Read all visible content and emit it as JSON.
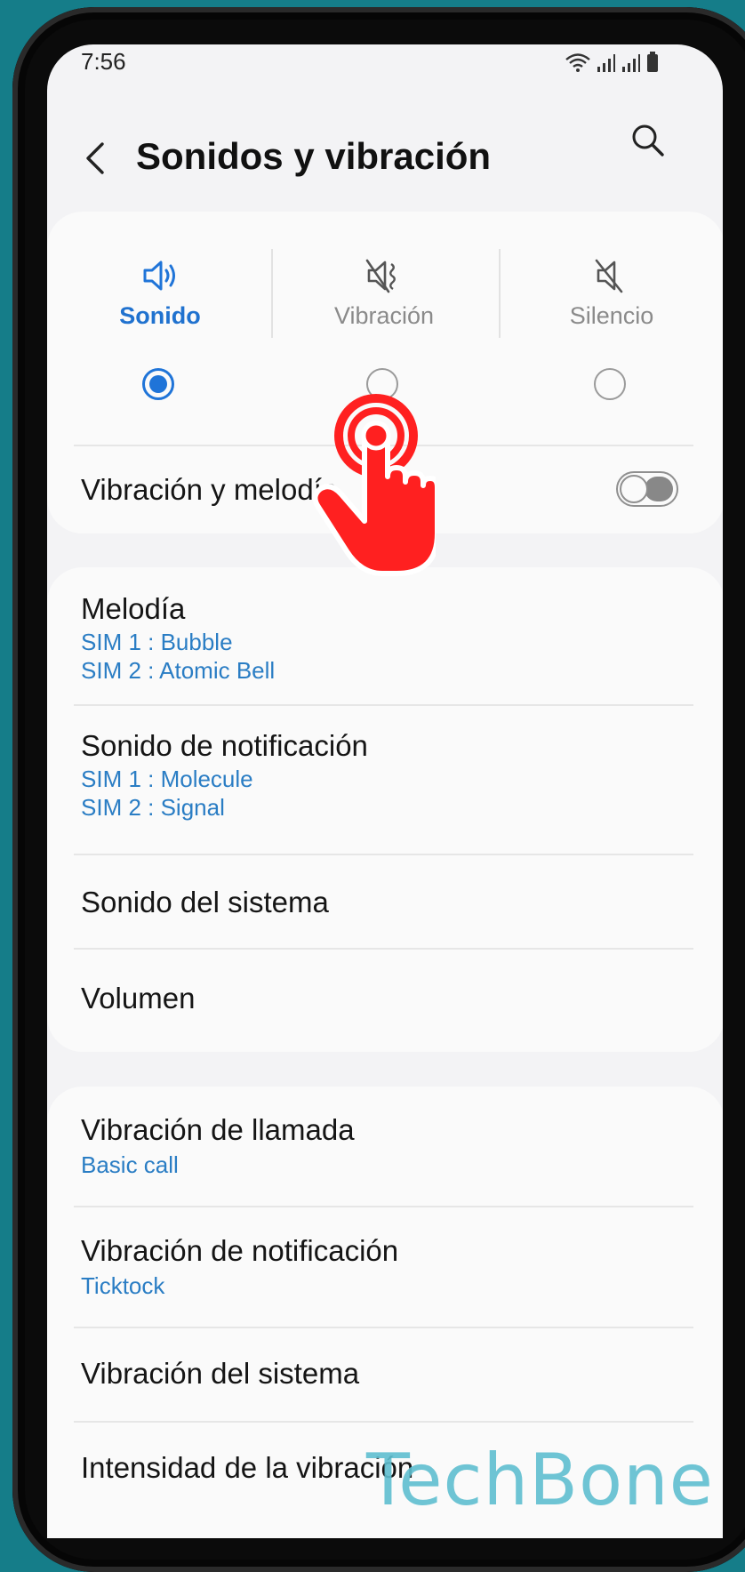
{
  "status_bar": {
    "time": "7:56"
  },
  "header": {
    "title": "Sonidos y vibración"
  },
  "sound_modes": [
    {
      "label": "Sonido",
      "selected": true,
      "icon": "speaker-icon"
    },
    {
      "label": "Vibración",
      "selected": false,
      "icon": "vibrate-icon"
    },
    {
      "label": "Silencio",
      "selected": false,
      "icon": "mute-icon"
    }
  ],
  "vibration_melody": {
    "label": "Vibración y melodía",
    "enabled": false
  },
  "sound_section": {
    "ringtone": {
      "label": "Melodía",
      "sim1": "SIM 1 : Bubble",
      "sim2": "SIM 2 : Atomic Bell"
    },
    "notification": {
      "label": "Sonido de notificación",
      "sim1": "SIM 1 : Molecule",
      "sim2": "SIM 2 : Signal"
    },
    "system_sound": {
      "label": "Sonido del sistema"
    },
    "volume": {
      "label": "Volumen"
    }
  },
  "vibration_section": {
    "call": {
      "label": "Vibración de llamada",
      "value": "Basic call"
    },
    "notification": {
      "label": "Vibración de notificación",
      "value": "Ticktock"
    },
    "system": {
      "label": "Vibración del sistema"
    },
    "intensity": {
      "label": "Intensidad de la vibración"
    }
  },
  "watermark": "TechBone",
  "colors": {
    "accent": "#1f74d8",
    "subtext": "#2a7dc4",
    "background": "#157d89",
    "pointer": "#ff2020"
  }
}
